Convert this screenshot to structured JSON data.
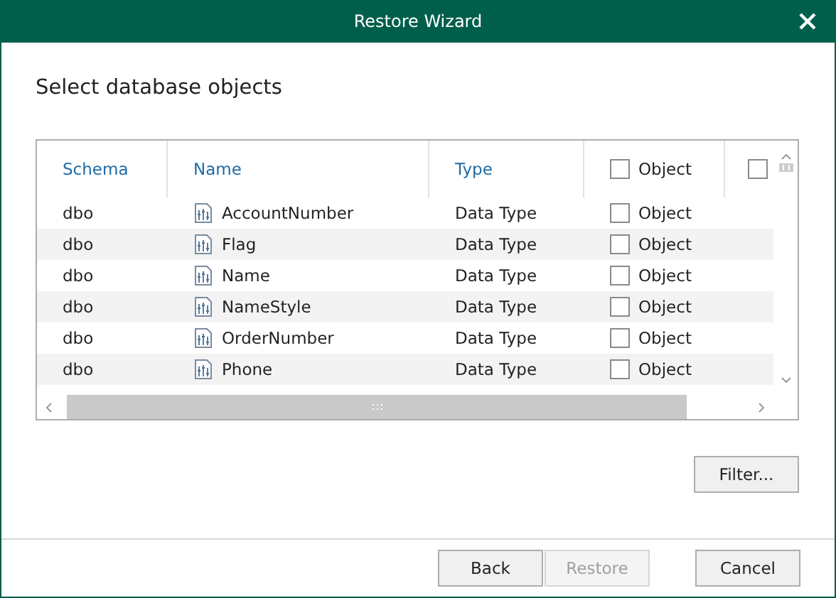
{
  "window": {
    "title": "Restore Wizard"
  },
  "heading": "Select database objects",
  "table": {
    "columns": [
      {
        "kind": "text",
        "label": "Schema"
      },
      {
        "kind": "text",
        "label": "Name"
      },
      {
        "kind": "text",
        "label": "Type"
      },
      {
        "kind": "check",
        "label": "Object",
        "checked": false
      },
      {
        "kind": "check",
        "checked": false
      }
    ],
    "rows": [
      {
        "schema": "dbo",
        "name": "AccountNumber",
        "type": "Data Type",
        "object": "Object",
        "checked": false
      },
      {
        "schema": "dbo",
        "name": "Flag",
        "type": "Data Type",
        "object": "Object",
        "checked": false
      },
      {
        "schema": "dbo",
        "name": "Name",
        "type": "Data Type",
        "object": "Object",
        "checked": false
      },
      {
        "schema": "dbo",
        "name": "NameStyle",
        "type": "Data Type",
        "object": "Object",
        "checked": false
      },
      {
        "schema": "dbo",
        "name": "OrderNumber",
        "type": "Data Type",
        "object": "Object",
        "checked": false
      },
      {
        "schema": "dbo",
        "name": "Phone",
        "type": "Data Type",
        "object": "Object",
        "checked": false
      }
    ]
  },
  "filter_button": "Filter...",
  "buttons": [
    {
      "label": "Back",
      "disabled": false
    },
    {
      "label": "Restore",
      "disabled": true
    },
    {
      "label": "Cancel",
      "disabled": false
    }
  ]
}
